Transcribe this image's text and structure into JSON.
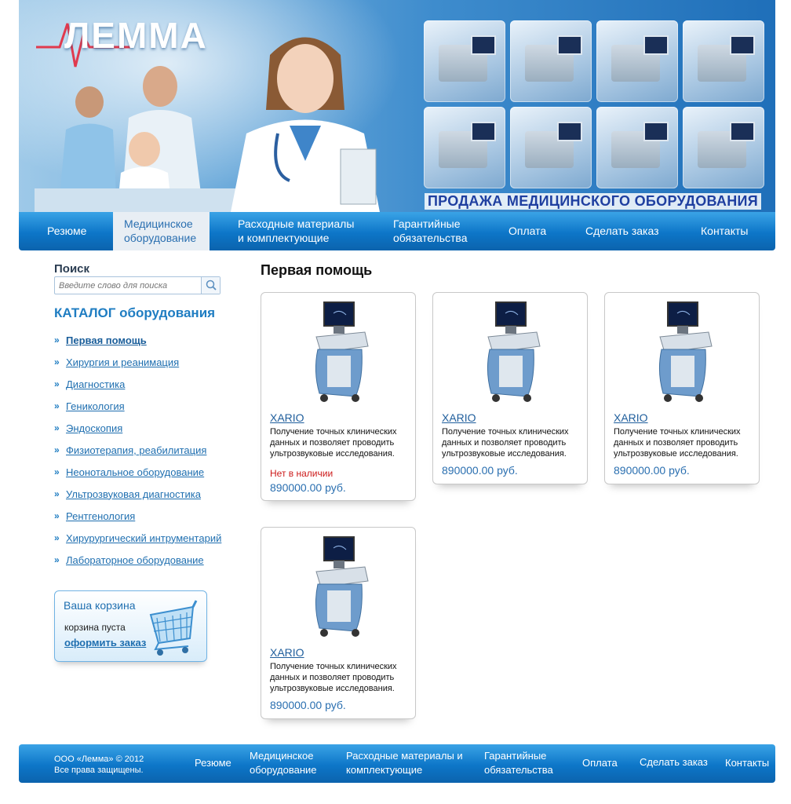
{
  "header": {
    "logo": "ЛЕММА",
    "tagline": "ПРОДАЖА МЕДИЦИНСКОГО ОБОРУДОВАНИЯ"
  },
  "nav": {
    "items": [
      {
        "label": "Резюме"
      },
      {
        "label": "Медицинское оборудование",
        "active": true
      },
      {
        "label": "Расходные материалы и комплектующие"
      },
      {
        "label": "Гарантийные обязательства"
      },
      {
        "label": "Оплата"
      },
      {
        "label": "Сделать заказ"
      },
      {
        "label": "Контакты"
      }
    ]
  },
  "sidebar": {
    "search_title": "Поиск",
    "search_placeholder": "Введите слово для поиска",
    "catalog_title": "КАТАЛОГ оборудования",
    "categories": [
      "Первая помощь",
      "Хирургия и реанимация",
      "Диагностика",
      "Геникология",
      "Эндоскопия",
      "Физиотерапия, реабилитация",
      "Неонотальное оборудование",
      "Ультрозвуковая диагностика",
      "Рентгенология",
      "Хирурургический интрументарий",
      "Лабораторное оборудование"
    ],
    "cart": {
      "title": "Ваша корзина",
      "status": "корзина пуста",
      "order_link": "оформить заказ"
    }
  },
  "main": {
    "title": "Первая помощь",
    "products": [
      {
        "name": "XARIO",
        "description": "Получение точных клинических данных и позволяет проводить ультрозвуковые исследования.",
        "stock": "Нет в наличии",
        "price": "890000.00 руб."
      },
      {
        "name": "XARIO",
        "description": "Получение точных клинических данных и позволяет проводить ультрозвуковые исследования.",
        "stock": "",
        "price": "890000.00 руб."
      },
      {
        "name": "XARIO",
        "description": "Получение точных клинических данных и позволяет проводить ультрозвуковые исследования.",
        "stock": "",
        "price": "890000.00 руб."
      },
      {
        "name": "XARIO",
        "description": "Получение точных клинических данных и позволяет проводить ультрозвуковые исследования.",
        "stock": "",
        "price": "890000.00 руб."
      }
    ]
  },
  "footer": {
    "copyright_line1": "ООО «Лемма» © 2012",
    "copyright_line2": "Все права защищены.",
    "items": [
      {
        "label": "Резюме"
      },
      {
        "label": "Медицинское оборудование"
      },
      {
        "label": "Расходные материалы и комплектующие"
      },
      {
        "label": "Гарантийные обязательства"
      },
      {
        "label": "Оплата"
      },
      {
        "label": "Сделать заказ"
      },
      {
        "label": "Контакты"
      }
    ]
  },
  "colors": {
    "brand_blue": "#1f7dc2",
    "nav_blue": "#0d76c8",
    "tagline": "#1f3fa0",
    "out_of_stock": "#cc1a1a"
  }
}
